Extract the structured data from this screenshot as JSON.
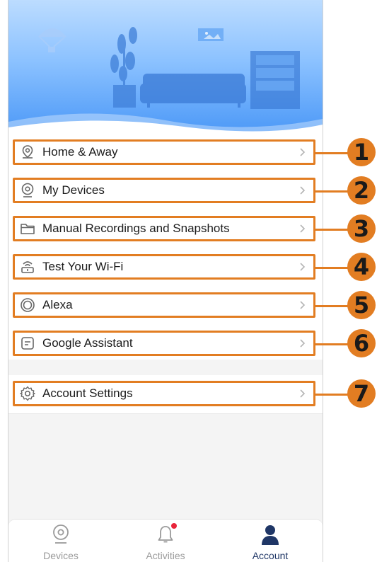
{
  "menu": {
    "items": [
      {
        "label": "Home & Away",
        "icon": "location-pin-icon",
        "badge": "1"
      },
      {
        "label": "My Devices",
        "icon": "camera-icon",
        "badge": "2"
      },
      {
        "label": "Manual Recordings and Snapshots",
        "icon": "folder-icon",
        "badge": "3"
      },
      {
        "label": "Test Your Wi-Fi",
        "icon": "router-icon",
        "badge": "4"
      },
      {
        "label": "Alexa",
        "icon": "alexa-icon",
        "badge": "5"
      },
      {
        "label": "Google Assistant",
        "icon": "google-assistant-icon",
        "badge": "6"
      },
      {
        "label": "Account Settings",
        "icon": "gear-icon",
        "badge": "7"
      }
    ]
  },
  "tabbar": {
    "tabs": [
      {
        "label": "Devices",
        "icon": "camera-icon",
        "active": false
      },
      {
        "label": "Activities",
        "icon": "bell-icon",
        "active": false,
        "has_notification_dot": true
      },
      {
        "label": "Account",
        "icon": "person-icon",
        "active": true
      }
    ]
  },
  "colors": {
    "highlight": "#e27d22",
    "header_blue": "#4b98f7",
    "active_tab": "#1f3666",
    "notification_dot": "#e8243a"
  }
}
